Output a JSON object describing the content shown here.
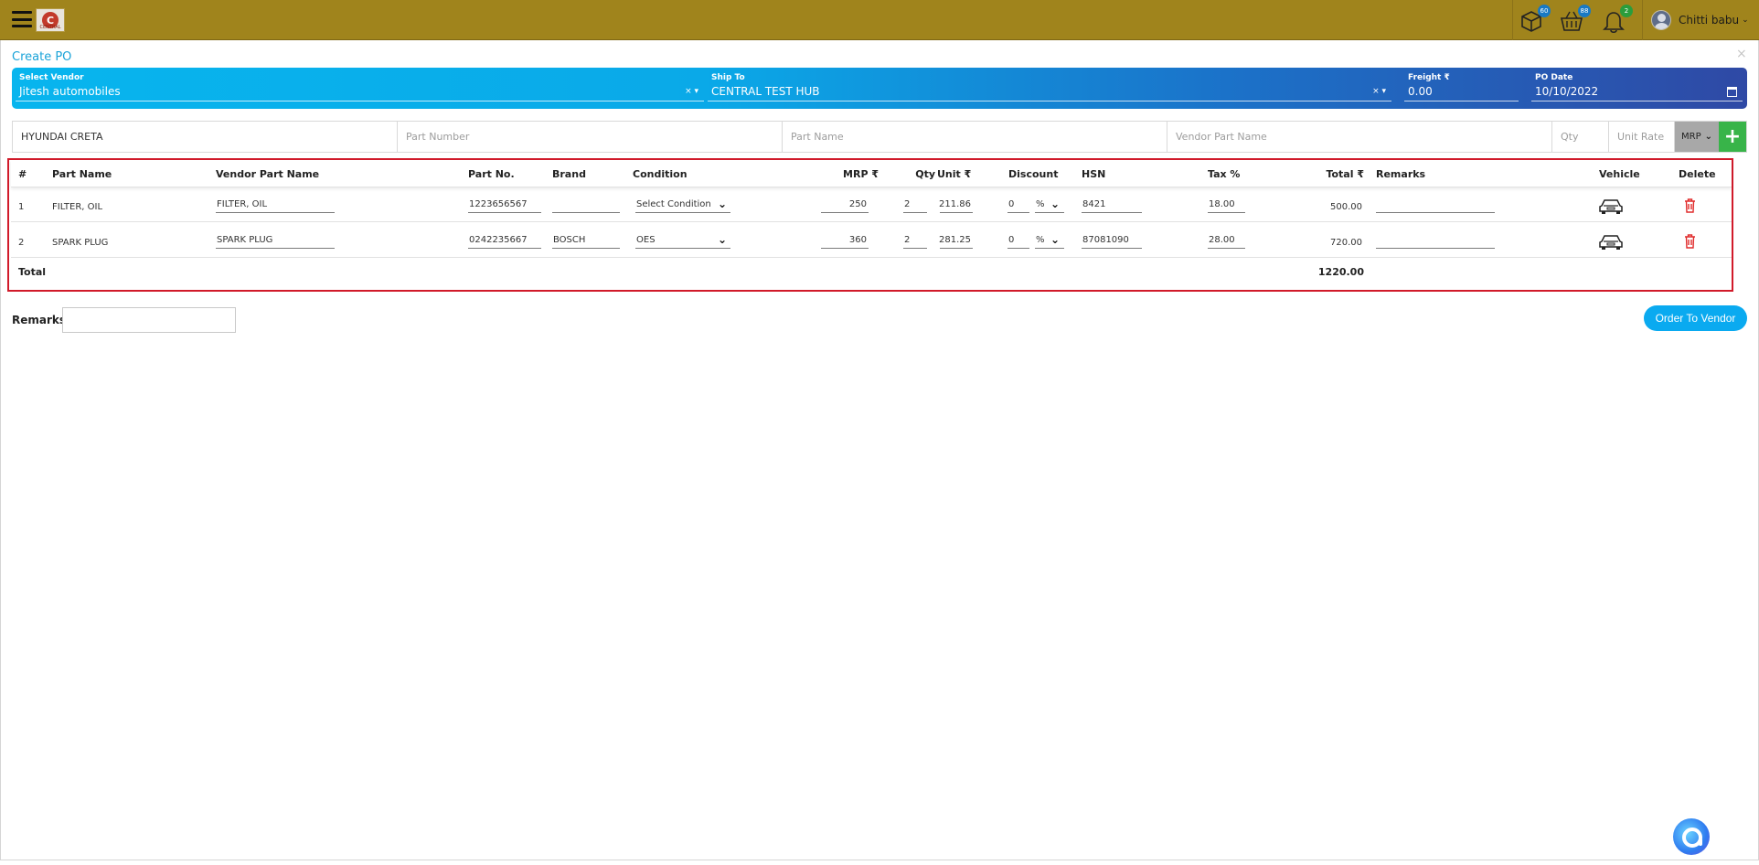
{
  "topbar": {
    "logo_text": "CENTRAL",
    "badges": {
      "parts": "60",
      "cart": "88",
      "notifications": "2"
    },
    "user_name": "Chitti babu"
  },
  "page": {
    "title": "Create PO",
    "close": "×"
  },
  "banner": {
    "vendor_label": "Select Vendor",
    "vendor_value": "Jitesh automobiles",
    "ship_label": "Ship To",
    "ship_value": "CENTRAL TEST HUB",
    "freight_label": "Freight ₹",
    "freight_value": "0.00",
    "date_label": "PO Date",
    "date_value": "10/10/2022",
    "clear_glyph": "× ▾"
  },
  "add_row": {
    "vehicle": "HYUNDAI CRETA",
    "part_number_ph": "Part Number",
    "part_name_ph": "Part Name",
    "vendor_part_name_ph": "Vendor Part Name",
    "qty_ph": "Qty",
    "unit_rate_ph": "Unit Rate",
    "rate_type": "MRP",
    "add_glyph": "+"
  },
  "table": {
    "headers": {
      "num": "#",
      "part_name": "Part Name",
      "vendor_part_name": "Vendor Part Name",
      "part_no": "Part No.",
      "brand": "Brand",
      "condition": "Condition",
      "mrp": "MRP ₹",
      "qty": "Qty",
      "unit": "Unit ₹",
      "discount": "Discount",
      "hsn": "HSN",
      "tax": "Tax %",
      "total": "Total ₹",
      "remarks": "Remarks",
      "vehicle": "Vehicle",
      "delete": "Delete"
    },
    "rows": [
      {
        "num": "1",
        "part_name": "FILTER, OIL",
        "vendor_part_name": "FILTER, OIL",
        "part_no": "1223656567",
        "brand": "",
        "condition": "Select Condition",
        "mrp": "250",
        "qty": "2",
        "unit": "211.86",
        "discount": "0",
        "discount_type": "%",
        "hsn": "8421",
        "tax": "18.00",
        "total": "500.00",
        "remarks": ""
      },
      {
        "num": "2",
        "part_name": "SPARK PLUG",
        "vendor_part_name": "SPARK PLUG",
        "part_no": "0242235667",
        "brand": "BOSCH",
        "condition": "OES",
        "mrp": "360",
        "qty": "2",
        "unit": "281.25",
        "discount": "0",
        "discount_type": "%",
        "hsn": "87081090",
        "tax": "28.00",
        "total": "720.00",
        "remarks": ""
      }
    ],
    "total_label": "Total",
    "grand_total": "1220.00"
  },
  "footer": {
    "remarks_label": "Remarks",
    "order_button": "Order To Vendor"
  },
  "colors": {
    "topbar": "#a0841c",
    "accent": "#0aaaf0",
    "highlight": "#d11a2a",
    "add": "#38b449",
    "delete": "#e02b2b"
  }
}
